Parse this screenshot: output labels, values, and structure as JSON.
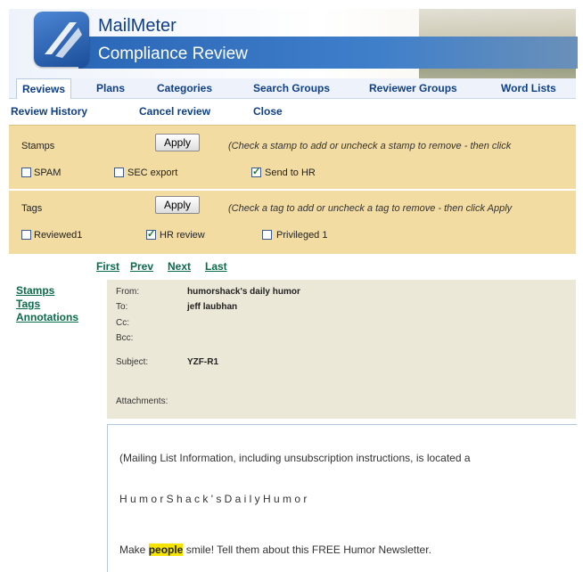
{
  "app": {
    "title": "MailMeter",
    "subtitle": "Compliance Review"
  },
  "tabs": [
    "Reviews",
    "Plans",
    "Categories",
    "Search Groups",
    "Reviewer Groups",
    "Word Lists"
  ],
  "actions": [
    "Review History",
    "Cancel review",
    "Close"
  ],
  "stamps": {
    "label": "Stamps",
    "apply_label": "Apply",
    "hint": "(Check a stamp to add or uncheck a stamp to remove - then click",
    "options": [
      {
        "label": "SPAM",
        "checked": false
      },
      {
        "label": "SEC export",
        "checked": false
      },
      {
        "label": "Send to HR",
        "checked": true
      }
    ]
  },
  "tags": {
    "label": "Tags",
    "apply_label": "Apply",
    "hint": "(Check a tag to add or uncheck a tag to remove - then click Apply",
    "options": [
      {
        "label": "Reviewed1",
        "checked": false
      },
      {
        "label": "HR review",
        "checked": true
      },
      {
        "label": "Privileged 1",
        "checked": false
      }
    ]
  },
  "pager": [
    "First",
    "Prev",
    "Next",
    "Last"
  ],
  "side_links": [
    "Stamps",
    "Tags",
    "Annotations"
  ],
  "email": {
    "from_label": "From:",
    "from": "humorshack's daily humor",
    "to_label": "To:",
    "to": "jeff laubhan",
    "cc_label": "Cc:",
    "bcc_label": "Bcc:",
    "subject_label": "Subject:",
    "subject": "YZF-R1",
    "attachments_label": "Attachments:",
    "body": {
      "line1": "(Mailing List Information, including unsubscription instructions, is located a",
      "line2": "H u m o r S h a c k ' s D a i l y H u m o r",
      "line3_pre": "Make ",
      "line3_highlight": "people",
      "line3_post": " smile! Tell them about this FREE Humor Newsletter."
    }
  }
}
